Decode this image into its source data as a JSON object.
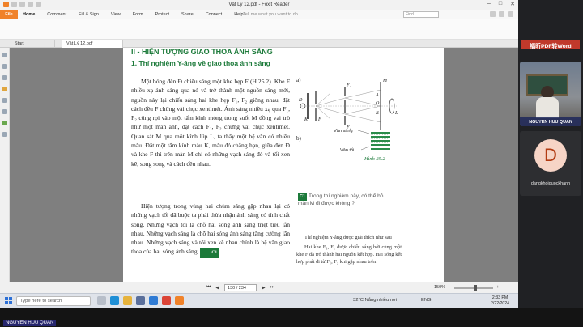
{
  "window": {
    "title": "Vật Lý 12.pdf - Foxit Reader"
  },
  "ribbon": {
    "file": "File",
    "tabs": [
      "Home",
      "Comment",
      "Fill & Sign",
      "View",
      "Form",
      "Protect",
      "Share",
      "Connect",
      "Help"
    ],
    "tell_me": "Tell me what you want to do...",
    "find_placeholder": "Find"
  },
  "doc_tabs": [
    "Start",
    "Vật Lý 12.pdf"
  ],
  "page": {
    "section_title": "II - HIỆN TƯỢNG GIAO THOA ÁNH SÁNG",
    "subsection_title": "1. Thí nghiệm Y-âng về giao thoa ánh sáng",
    "para1": "Một bóng đèn Đ chiếu sáng một khe hẹp F (H.25.2). Khe F nhiều xạ ánh sáng qua nó và trở thành một nguồn sáng mới, nguồn này lại chiếu sáng hai khe hẹp F₁, F₂ giống nhau, đặt cách đều F chừng vài chục xentimét. Ánh sáng nhiều xạ qua F₁, F₂ cũng rọi vào một tấm kính mỏng trong suốt M đồng vai trò như một màn ảnh, đặt cách F₁, F₂ chừng vài chục xentimét. Quan sát M qua một kính lúp L, ta thấy một hệ vân có nhiều màu. Đặt một tấm kính màu K, màu đỏ chẳng hạn, giữa đèn Đ và khe F thì trên màn M chỉ có những vạch sáng đỏ và tối xen kẽ, song song và cách đều nhau.",
    "para2": "Hiện tượng trong vùng hai chùm sáng gặp nhau lại có những vạch tối đã buộc ta phải thừa nhận ánh sáng có tính chất sóng. Những vạch tối là chỗ hai sóng ánh sáng triệt tiêu lẫn nhau. Những vạch sáng là chỗ hai sóng ánh sáng tăng cường lẫn nhau. Những vạch sáng và tối xen kẽ nhau chính là hệ vân giao thoa của hai sóng ánh sáng.",
    "para2_badge": "C1",
    "figure": {
      "label_a": "a)",
      "label_b": "b)",
      "F": "F",
      "F1": "F₁",
      "F2": "F₂",
      "K": "K",
      "D": "Đ",
      "M": "M",
      "L": "L",
      "O": "O",
      "A": "A",
      "B": "B",
      "van_sang": "Vân sáng",
      "van_toi": "Vân tối",
      "caption": "Hình 25.2"
    },
    "c1_badge": "C1",
    "c1_text": "Trong thí nghiệm này, có thể bỏ màn M đi được không ?",
    "note1": "Thí nghiệm Y-âng được giải thích như sau :",
    "note2": "Hai khe F₁, F₂ được chiếu sáng bởi cùng một khe F đã trở thành hai nguồn kết hợp. Hai sóng kết hợp phát đi từ F₁, F₂ khi gặp nhau trên"
  },
  "statusbar": {
    "page_indicator": "130 / 234",
    "zoom": "150%",
    "zoom_level_percent": 55
  },
  "taskbar": {
    "search": "Type here to search",
    "weather": "32°C  Nắng nhiều nơi",
    "lang": "ENG",
    "time": "2:33 PM",
    "date": "2/22/2024"
  },
  "side": {
    "ad": "福昕PDF转Word",
    "tile1_name": "NGUYEN HUU QUAN",
    "tile2_initial": "D",
    "tile2_name": "dangkhoiquockhanh"
  },
  "footer_label": "NGUYEN HUU QUAN",
  "colors": {
    "accent": "#f0822a",
    "heading_green": "#1c7a3a",
    "taskbar": "#dfe3ea"
  }
}
